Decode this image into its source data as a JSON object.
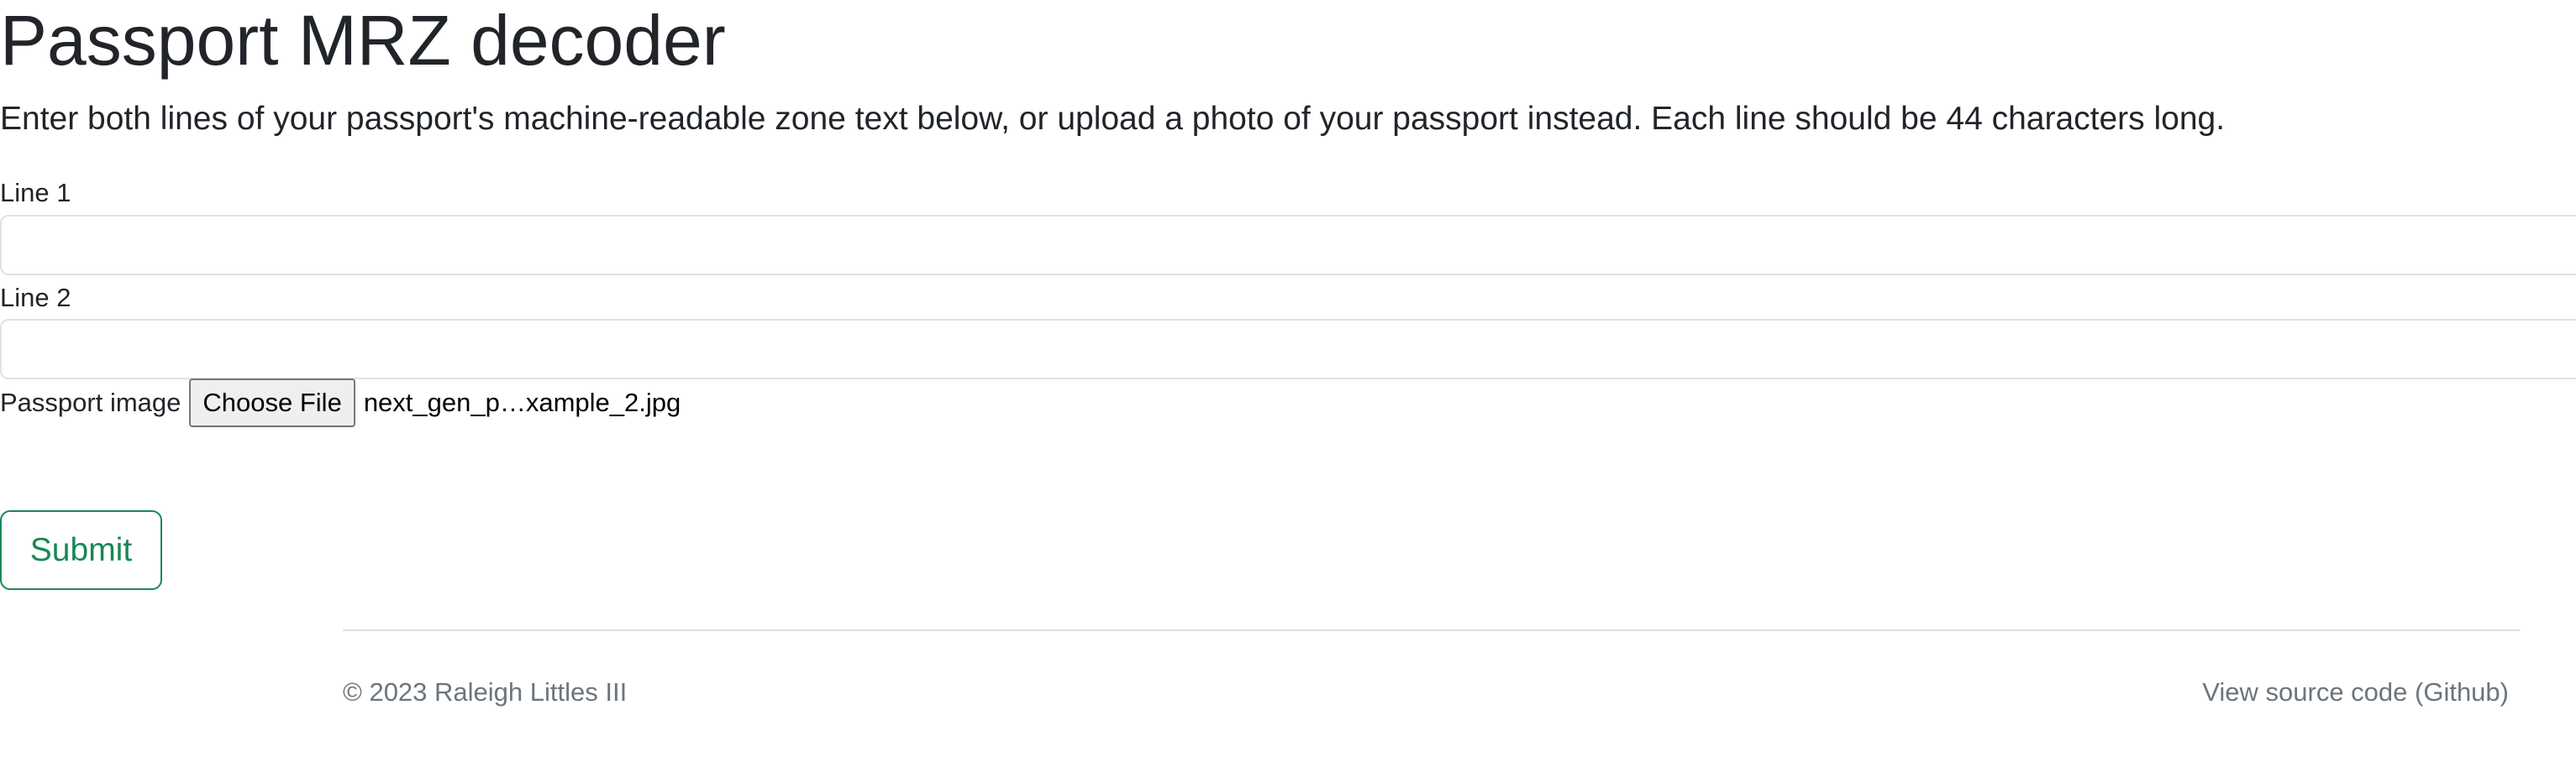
{
  "page": {
    "title": "Passport MRZ decoder",
    "lead": "Enter both lines of your passport's machine-readable zone text below, or upload a photo of your passport instead. Each line should be 44 characters long."
  },
  "form": {
    "line1": {
      "label": "Line 1",
      "value": "",
      "placeholder": ""
    },
    "line2": {
      "label": "Line 2",
      "value": "",
      "placeholder": ""
    },
    "image": {
      "label": "Passport image",
      "button_label": "Choose File",
      "file_name": "next_gen_p…xample_2.jpg"
    },
    "submit_label": "Submit"
  },
  "footer": {
    "copyright": "© 2023 Raleigh Littles III",
    "source_link": "View source code (Github)"
  },
  "colors": {
    "text": "#212529",
    "muted": "#6c757d",
    "success": "#198754",
    "border": "#dee2e6"
  }
}
